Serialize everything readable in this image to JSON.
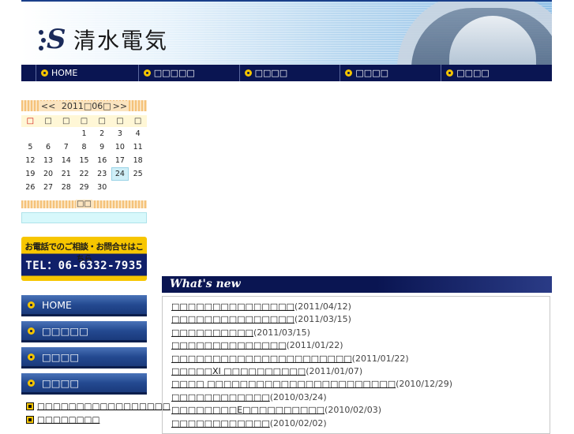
{
  "header": {
    "logo_text": "清水電気"
  },
  "nav": {
    "items": [
      {
        "label": "HOME"
      },
      {
        "label": "□□□□□"
      },
      {
        "label": "□□□□"
      },
      {
        "label": "□□□□"
      },
      {
        "label": "□□□□"
      }
    ]
  },
  "calendar": {
    "prev": "<<",
    "title": "2011□06□",
    "next": ">>",
    "weekdays": [
      "□",
      "□",
      "□",
      "□",
      "□",
      "□",
      "□"
    ],
    "weeks": [
      [
        "",
        "",
        "",
        "1",
        "2",
        "3",
        "4"
      ],
      [
        "5",
        "6",
        "7",
        "8",
        "9",
        "10",
        "11"
      ],
      [
        "12",
        "13",
        "14",
        "15",
        "16",
        "17",
        "18"
      ],
      [
        "19",
        "20",
        "21",
        "22",
        "23",
        "24",
        "25"
      ],
      [
        "26",
        "27",
        "28",
        "29",
        "30",
        "",
        ""
      ]
    ],
    "today": "24"
  },
  "category": {
    "title": "□□"
  },
  "phone_banner": {
    "top_text": "お電話でのご相談・お問合せはこちら",
    "tel": "TEL：06-6332-7935"
  },
  "sidemenu": {
    "buttons": [
      {
        "label": "HOME"
      },
      {
        "label": "□□□□□"
      },
      {
        "label": "□□□□"
      },
      {
        "label": "□□□□"
      }
    ],
    "links": [
      {
        "label": "□□□□□□□□□□□□□□□□□"
      },
      {
        "label": "□□□□□□□□"
      }
    ]
  },
  "whats_new": {
    "title": "What's new",
    "items": [
      {
        "text": "□□□□□□□□□□□□□□□",
        "date": "(2011/04/12)"
      },
      {
        "text": "□□□□□□□□□□□□□□□",
        "date": "(2011/03/15)"
      },
      {
        "text": "□□□□□□□□□□",
        "date": "(2011/03/15)"
      },
      {
        "text": "□□□□□□□□□□□□□□",
        "date": "(2011/01/22)"
      },
      {
        "text": "□□□□□□□□□□□□□□□□□□□□□□",
        "date": "(2011/01/22)"
      },
      {
        "text": "□□□□□XI □□□□□□□□□□",
        "date": "(2011/01/07)"
      },
      {
        "text": "□□□□ □□□□□□□□□□□□□□□□□□□□□□□",
        "date": "(2010/12/29)"
      },
      {
        "text": "□□□□□□□□□□□□",
        "date": "(2010/03/24)"
      },
      {
        "text": "□□□□□□□□E□□□□□□□□□□",
        "date": "(2010/02/03)"
      },
      {
        "text": "□□□□□□□□□□□□",
        "date": "(2010/02/02)"
      }
    ]
  }
}
